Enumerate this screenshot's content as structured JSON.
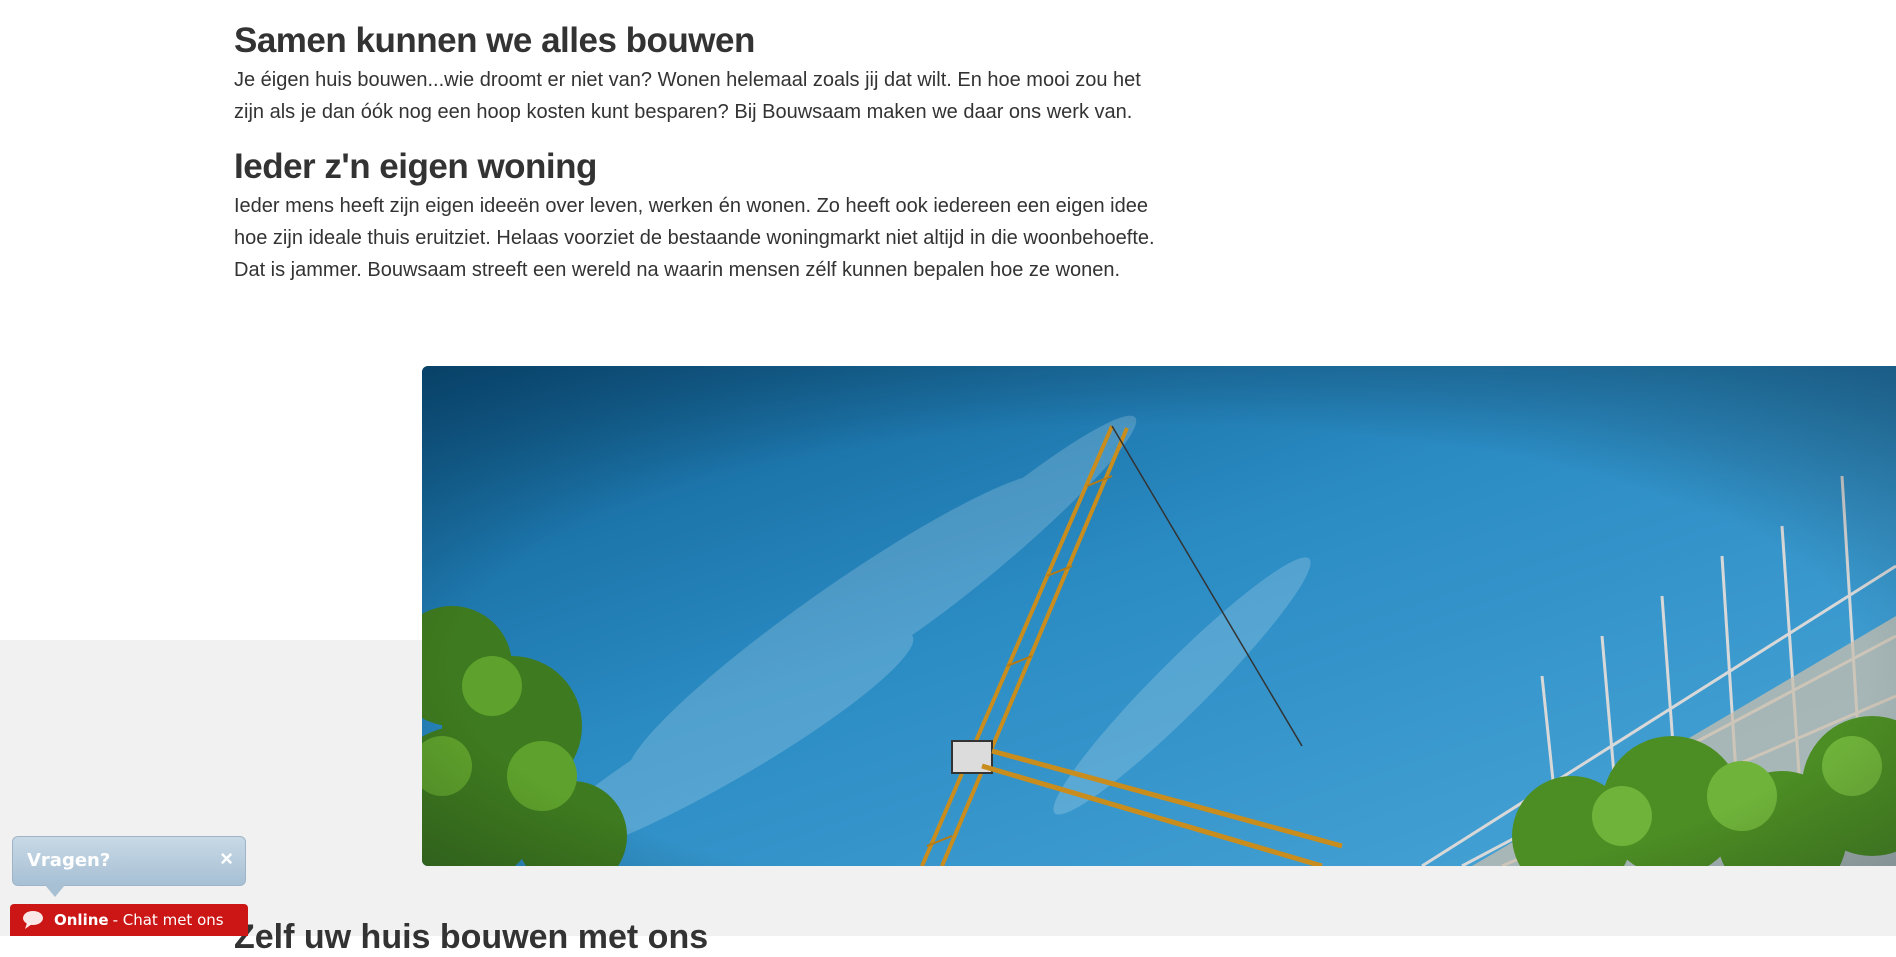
{
  "sections": [
    {
      "heading": "Samen kunnen we alles bouwen",
      "body": "Je éigen huis bouwen...wie droomt er niet van? Wonen helemaal zoals jij dat wilt. En hoe mooi zou het zijn als je dan óók nog een hoop kosten kunt besparen? Bij Bouwsaam maken we daar ons werk van."
    },
    {
      "heading": "Ieder z'n eigen woning",
      "body": "Ieder mens heeft zijn eigen ideeën over leven, werken én wonen. Zo heeft ook iedereen een eigen idee hoe zijn ideale thuis eruitziet. Helaas voorziet de bestaande woningmarkt niet altijd in die woonbehoefte. Dat is jammer. Bouwsaam streeft een wereld na waarin mensen zélf kunnen bepalen hoe ze wonen."
    }
  ],
  "next_heading_partial": "Zelf uw huis bouwen met ons",
  "chat": {
    "bubble_title": "Vragen?",
    "close_icon": "×",
    "status": "Online",
    "cta": "- Chat met ons"
  },
  "colors": {
    "chat_red": "#cc1515",
    "text": "#333333",
    "band": "#f1f1f1"
  }
}
